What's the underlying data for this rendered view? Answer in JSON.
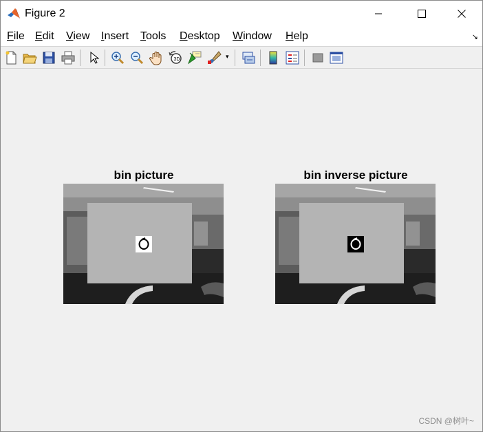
{
  "window": {
    "title": "Figure 2"
  },
  "menu": [
    {
      "label": "File",
      "mnemonic": "F",
      "rest": "ile"
    },
    {
      "label": "Edit",
      "mnemonic": "E",
      "rest": "dit"
    },
    {
      "label": "View",
      "mnemonic": "V",
      "rest": "iew"
    },
    {
      "label": "Insert",
      "mnemonic": "I",
      "rest": "nsert"
    },
    {
      "label": "Tools",
      "mnemonic": "T",
      "rest": "ools"
    },
    {
      "label": "Desktop",
      "mnemonic": "D",
      "rest": "esktop"
    },
    {
      "label": "Window",
      "mnemonic": "W",
      "rest": "indow"
    },
    {
      "label": "Help",
      "mnemonic": "H",
      "rest": "elp"
    }
  ],
  "toolbar": [
    "new-figure-icon",
    "open-file-icon",
    "save-icon",
    "print-icon",
    "select-arrow-icon",
    "zoom-in-icon",
    "zoom-out-icon",
    "pan-hand-icon",
    "rotate-3d-icon",
    "data-cursor-icon",
    "brush-icon",
    "link-plot-icon",
    "colorbar-icon",
    "legend-icon",
    "hide-plot-tools-icon",
    "show-plot-tools-icon"
  ],
  "plots": [
    {
      "title": "bin picture",
      "marker": "white"
    },
    {
      "title": "bin inverse picture",
      "marker": "black"
    }
  ],
  "watermark": "CSDN @树叶~"
}
